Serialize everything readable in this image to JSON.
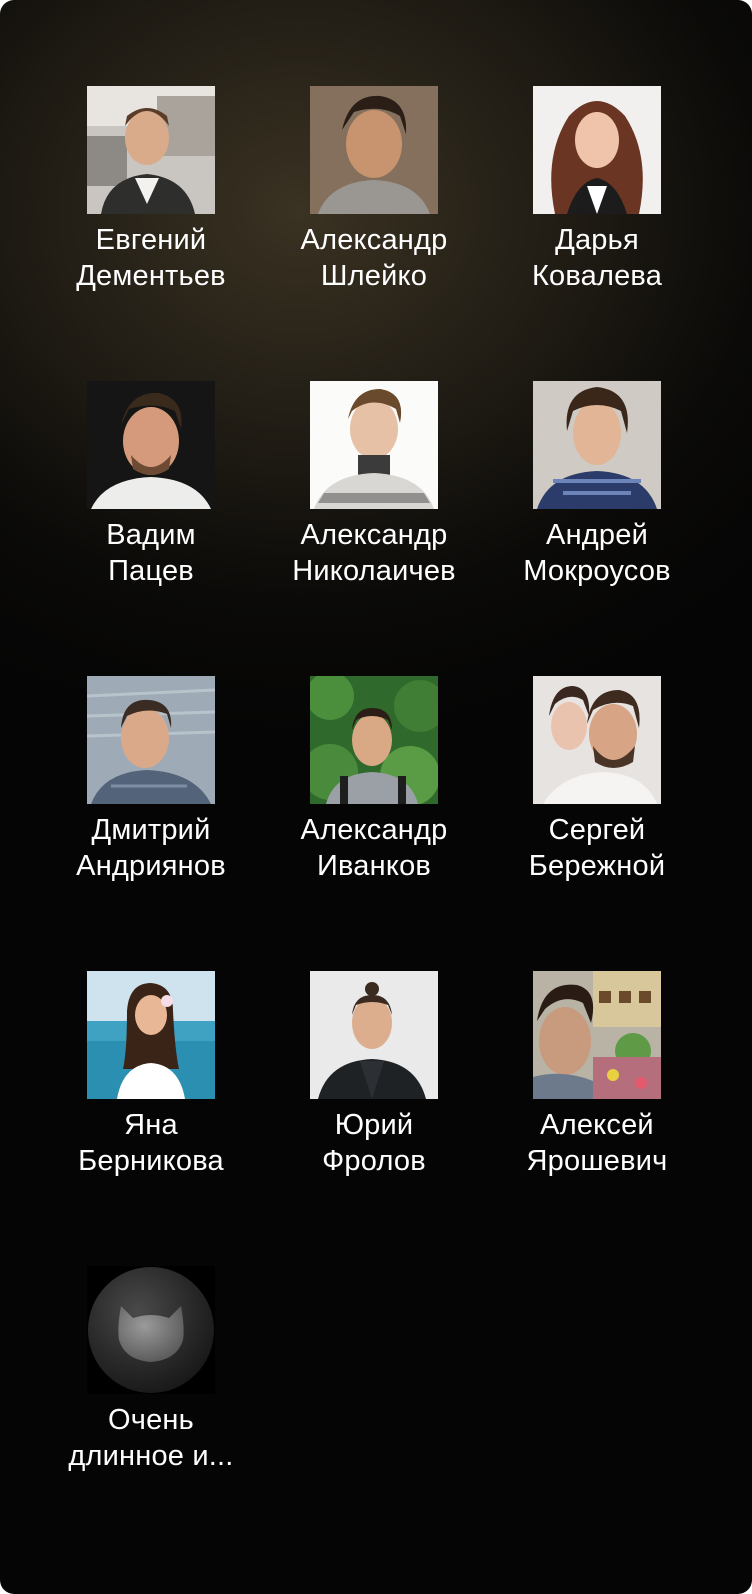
{
  "contacts": [
    {
      "first": "Евгений",
      "last": "Дементьев"
    },
    {
      "first": "Александр",
      "last": "Шлейко"
    },
    {
      "first": "Дарья",
      "last": "Ковалева"
    },
    {
      "first": "Вадим",
      "last": "Пацев"
    },
    {
      "first": "Александр",
      "last": "Николаичев"
    },
    {
      "first": "Андрей",
      "last": "Мокроусов"
    },
    {
      "first": "Дмитрий",
      "last": "Андриянов"
    },
    {
      "first": "Александр",
      "last": "Иванков"
    },
    {
      "first": "Сергей",
      "last": "Бережной"
    },
    {
      "first": "Яна",
      "last": "Берникова"
    },
    {
      "first": "Юрий",
      "last": "Фролов"
    },
    {
      "first": "Алексей",
      "last": "Ярошевич"
    },
    {
      "first": "Очень",
      "last": "длинное и..."
    }
  ]
}
